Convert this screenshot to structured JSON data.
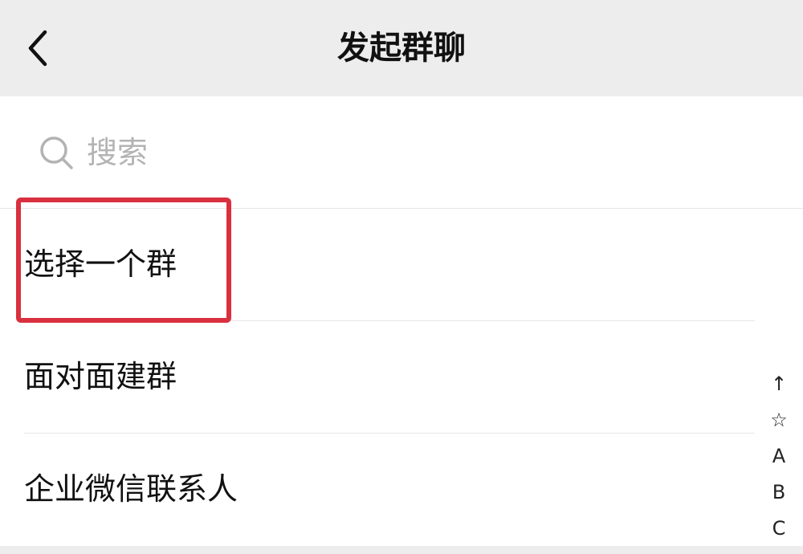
{
  "header": {
    "title": "发起群聊",
    "back_icon": "chevron-left-icon"
  },
  "search": {
    "placeholder": "搜索",
    "value": "",
    "icon": "search-icon"
  },
  "menu": {
    "items": [
      {
        "label": "选择一个群",
        "highlighted": true
      },
      {
        "label": "面对面建群"
      },
      {
        "label": "企业微信联系人"
      }
    ]
  },
  "index": {
    "items": [
      "↑",
      "☆",
      "A",
      "B",
      "C"
    ]
  },
  "colors": {
    "nav_background": "#ededed",
    "highlight_border": "#d9303f",
    "placeholder": "#b3b3b3"
  }
}
